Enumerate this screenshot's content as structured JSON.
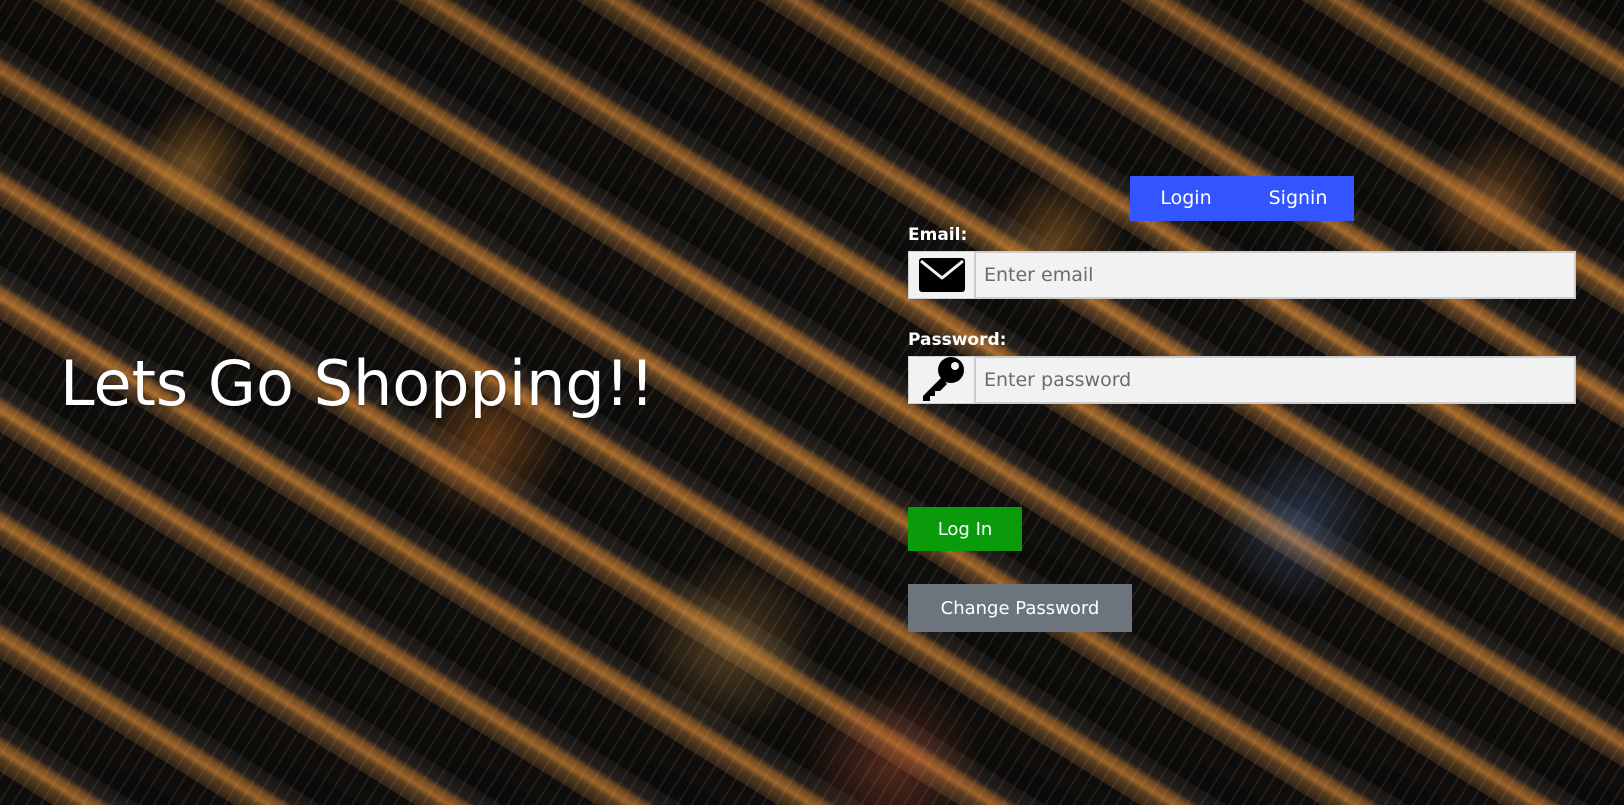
{
  "background": {
    "description_icon": "night-market-aerial-photo"
  },
  "hero": {
    "title": "Lets Go Shopping!!"
  },
  "tabs": [
    {
      "label": "Login"
    },
    {
      "label": "Signin"
    }
  ],
  "form": {
    "email": {
      "label": "Email:",
      "placeholder": "Enter email",
      "icon": "envelope-icon"
    },
    "password": {
      "label": "Password:",
      "placeholder": "Enter password",
      "icon": "key-icon"
    }
  },
  "buttons": {
    "login": "Log In",
    "change_password": "Change Password"
  },
  "colors": {
    "tab_bar": "#3355ff",
    "login_button": "#0a9b0a",
    "change_password_button": "#6c757d",
    "input_background": "#f2f2f2"
  }
}
